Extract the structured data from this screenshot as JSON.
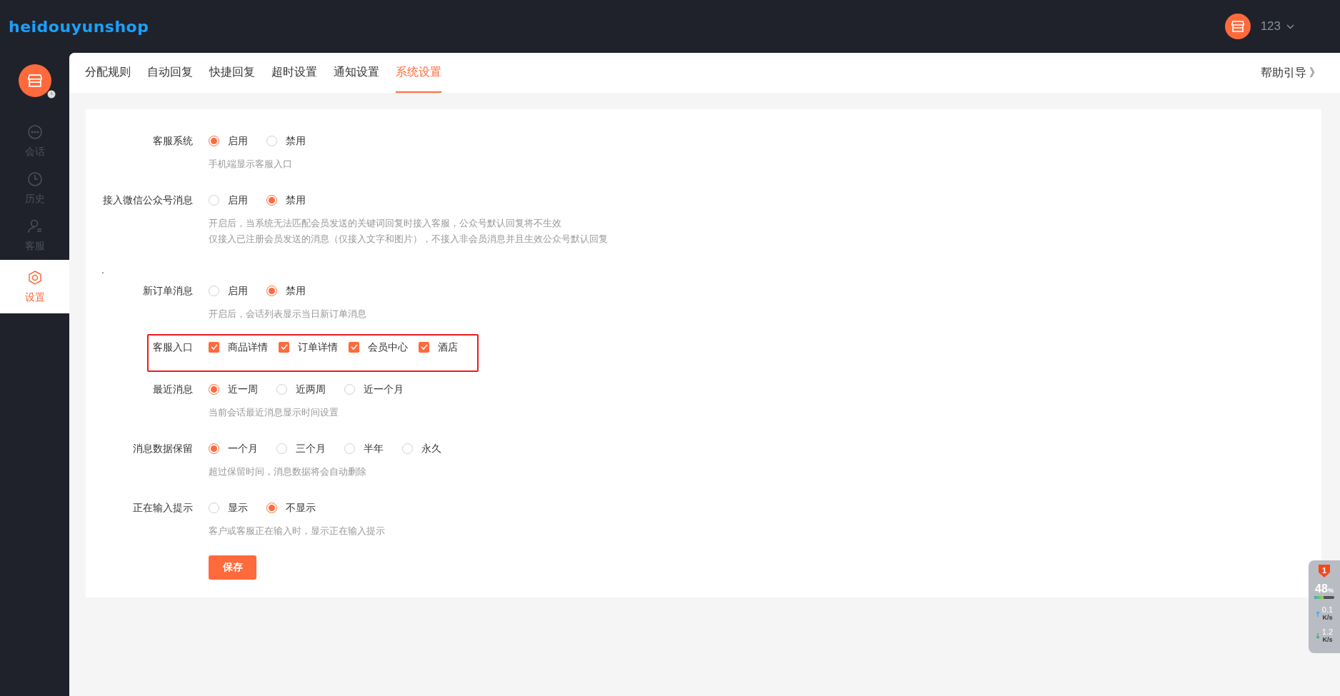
{
  "header": {
    "logo": "heidouyunshop",
    "user_name": "123"
  },
  "sidebar": {
    "items": [
      {
        "label": "会话",
        "kind": "chat",
        "selected": false
      },
      {
        "label": "历史",
        "kind": "history",
        "selected": false
      },
      {
        "label": "客服",
        "kind": "agent",
        "selected": false
      },
      {
        "label": "设置",
        "kind": "settings",
        "selected": true
      }
    ]
  },
  "tabs": [
    {
      "label": "分配规则",
      "selected": false
    },
    {
      "label": "自动回复",
      "selected": false
    },
    {
      "label": "快捷回复",
      "selected": false
    },
    {
      "label": "超时设置",
      "selected": false
    },
    {
      "label": "通知设置",
      "selected": false
    },
    {
      "label": "系统设置",
      "selected": true
    }
  ],
  "help_link": "帮助引导 》",
  "settings": [
    {
      "kind": "radio",
      "label": "客服系统",
      "options": [
        {
          "label": "启用",
          "selected": true
        },
        {
          "label": "禁用",
          "selected": false
        }
      ],
      "descriptions": [
        "手机端显示客服入口"
      ]
    },
    {
      "kind": "radio",
      "label": "接入微信公众号消息",
      "options": [
        {
          "label": "启用",
          "selected": false
        },
        {
          "label": "禁用",
          "selected": true
        }
      ],
      "descriptions": [
        "开启后，当系统无法匹配会员发送的关键词回复时接入客服，公众号默认回复将不生效",
        "仅接入已注册会员发送的消息（仅接入文字和图片），不接入非会员消息并且生效公众号默认回复"
      ]
    },
    {
      "kind": "mark",
      "label": "."
    },
    {
      "kind": "radio",
      "label": "新订单消息",
      "options": [
        {
          "label": "启用",
          "selected": false
        },
        {
          "label": "禁用",
          "selected": true
        }
      ],
      "descriptions": [
        "开启后，会话列表显示当日新订单消息"
      ]
    },
    {
      "kind": "checkbox",
      "label": "客服入口",
      "highlighted": true,
      "options": [
        {
          "label": "商品详情",
          "checked": true
        },
        {
          "label": "订单详情",
          "checked": true
        },
        {
          "label": "会员中心",
          "checked": true
        },
        {
          "label": "酒店",
          "checked": true
        }
      ]
    },
    {
      "kind": "radio",
      "label": "最近消息",
      "options": [
        {
          "label": "近一周",
          "selected": true
        },
        {
          "label": "近两周",
          "selected": false
        },
        {
          "label": "近一个月",
          "selected": false
        }
      ],
      "descriptions": [
        "当前会话最近消息显示时间设置"
      ]
    },
    {
      "kind": "radio",
      "label": "消息数据保留",
      "options": [
        {
          "label": "一个月",
          "selected": true
        },
        {
          "label": "三个月",
          "selected": false
        },
        {
          "label": "半年",
          "selected": false
        },
        {
          "label": "永久",
          "selected": false
        }
      ],
      "descriptions": [
        "超过保留时间，消息数据将会自动删除"
      ]
    },
    {
      "kind": "radio",
      "label": "正在输入提示",
      "options": [
        {
          "label": "显示",
          "selected": false
        },
        {
          "label": "不显示",
          "selected": true
        }
      ],
      "descriptions": [
        "客户或客服正在输入时，显示正在输入提示"
      ]
    }
  ],
  "save_button": "保存",
  "system_monitor": {
    "alert_count": "1",
    "usage": "48",
    "usage_unit": "%",
    "level": 0.48,
    "upload": "0.1",
    "upload_unit": "K/s",
    "download": "1.2",
    "download_unit": "K/s"
  }
}
